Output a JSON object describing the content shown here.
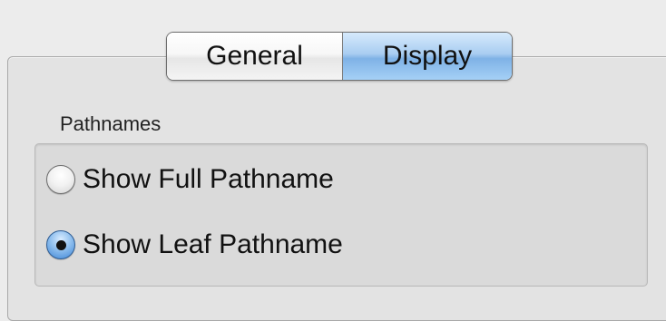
{
  "tabs": [
    {
      "label": "General",
      "selected": false
    },
    {
      "label": "Display",
      "selected": true
    }
  ],
  "pathnames": {
    "group_label": "Pathnames",
    "options": [
      {
        "label": "Show Full Pathname",
        "selected": false
      },
      {
        "label": "Show Leaf Pathname",
        "selected": true
      }
    ]
  },
  "colors": {
    "selected_tab": "#a9cdf1",
    "panel_background": "#e3e3e3",
    "window_background": "#ececec"
  }
}
